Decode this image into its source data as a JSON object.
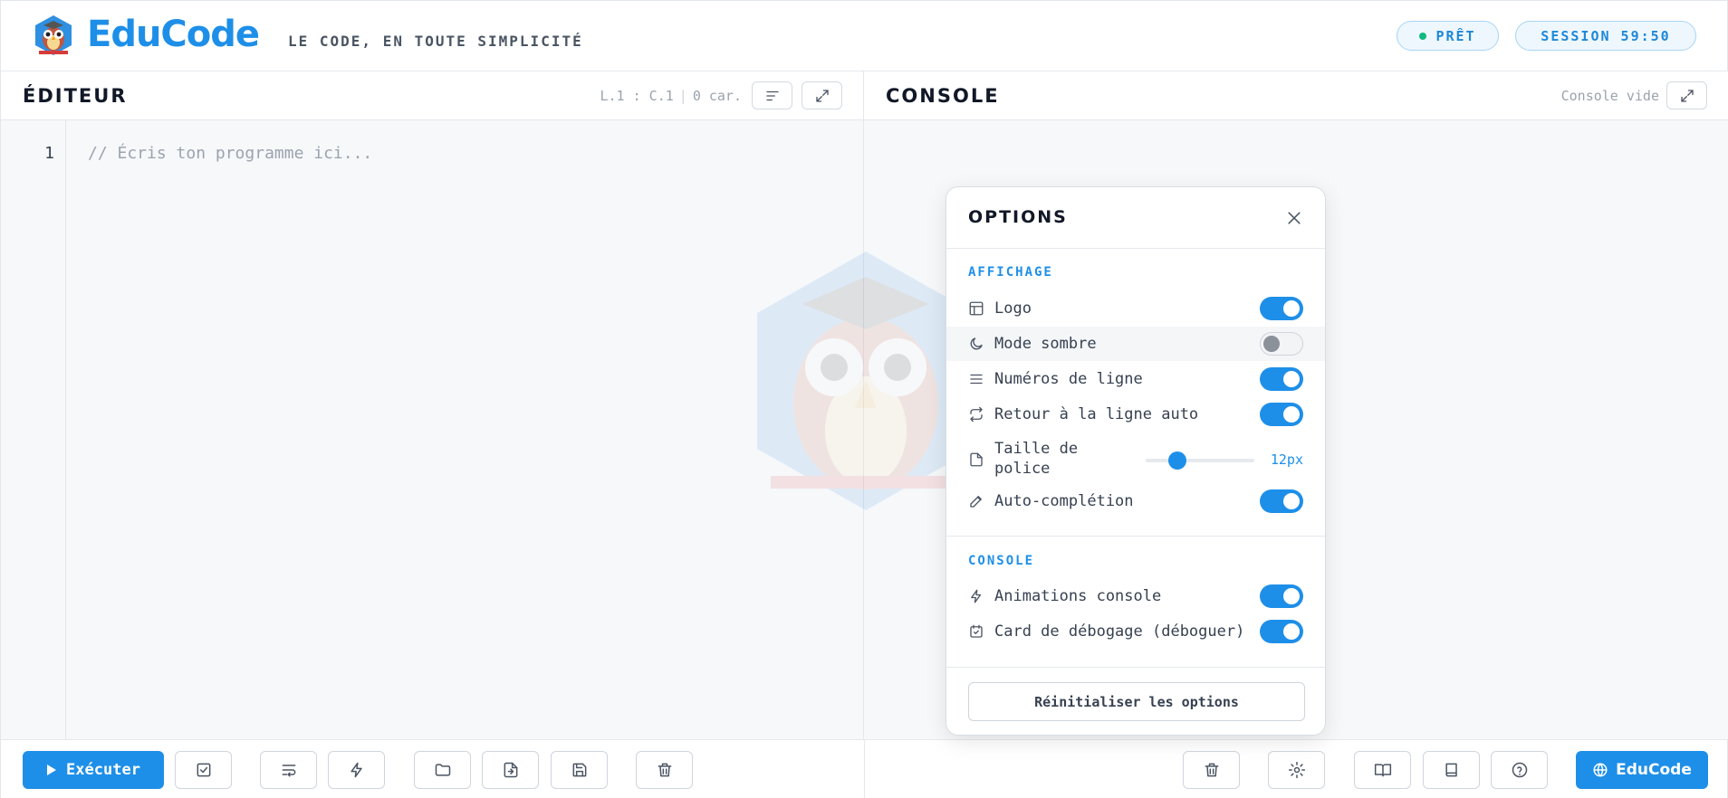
{
  "app": {
    "brand": "EduCode",
    "tagline": "LE CODE, EN TOUTE SIMPLICITÉ",
    "status": "PRÊT",
    "session": "SESSION 59:50"
  },
  "editor": {
    "title": "ÉDITEUR",
    "cursor": "L.1 : C.1",
    "chars": "0 car.",
    "line_number": "1",
    "placeholder": "// Écris ton programme ici..."
  },
  "console": {
    "title": "CONSOLE",
    "status": "Console vide"
  },
  "footer": {
    "run_label": "Exécuter",
    "educode_label": "EduCode"
  },
  "options": {
    "title": "OPTIONS",
    "display_section": "AFFICHAGE",
    "console_section": "CONSOLE",
    "items": [
      {
        "label": "Logo",
        "icon": "layout-icon",
        "enabled": true
      },
      {
        "label": "Mode sombre",
        "icon": "moon-icon",
        "enabled": false
      },
      {
        "label": "Numéros de ligne",
        "icon": "lines-icon",
        "enabled": true
      },
      {
        "label": "Retour à la ligne auto",
        "icon": "repeat-icon",
        "enabled": true
      },
      {
        "label": "Auto-complétion",
        "icon": "pencil-icon",
        "enabled": true
      },
      {
        "label": "Animations console",
        "icon": "bolt-icon",
        "enabled": true
      },
      {
        "label": "Card de débogage (déboguer)",
        "icon": "calendar-check-icon",
        "enabled": true
      }
    ],
    "font_size": {
      "label": "Taille de police",
      "value": "12px",
      "fraction": 0.29
    },
    "reset_label": "Réinitialiser les options"
  },
  "colors": {
    "accent": "#1e8fe8",
    "ready_dot": "#10b981"
  }
}
